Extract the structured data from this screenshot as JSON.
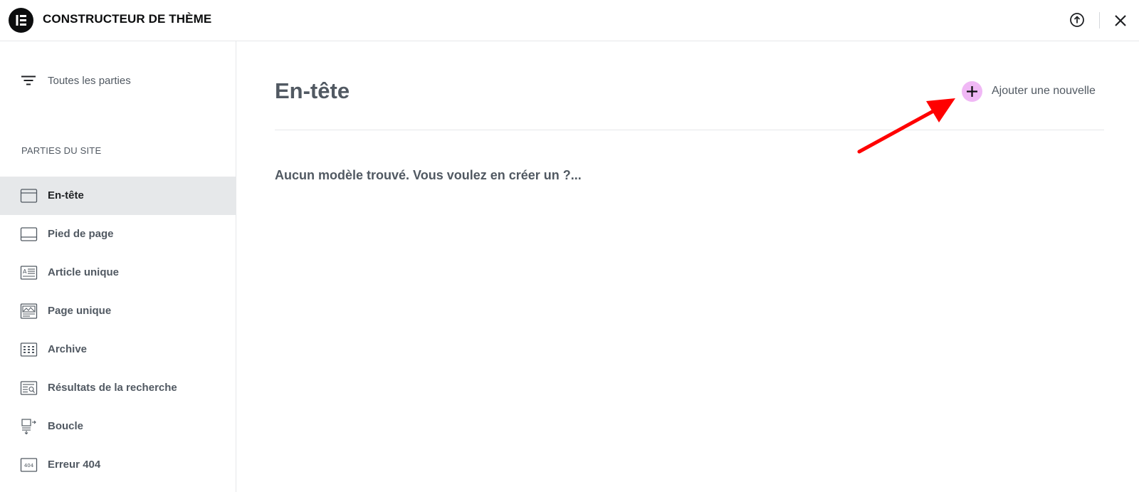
{
  "app": {
    "title": "CONSTRUCTEUR DE THÈME",
    "logo_icon": "elementor-logo"
  },
  "topbar": {
    "help_icon": "arrow-up-circle-icon",
    "close_icon": "close-icon"
  },
  "sidebar": {
    "all_parts_label": "Toutes les parties",
    "section_label": "PARTIES DU SITE",
    "items": [
      {
        "label": "En-tête",
        "icon": "header-icon",
        "active": true
      },
      {
        "label": "Pied de page",
        "icon": "footer-icon",
        "active": false
      },
      {
        "label": "Article unique",
        "icon": "single-post-icon",
        "active": false
      },
      {
        "label": "Page unique",
        "icon": "single-page-icon",
        "active": false
      },
      {
        "label": "Archive",
        "icon": "archive-icon",
        "active": false
      },
      {
        "label": "Résultats de la recherche",
        "icon": "search-results-icon",
        "active": false
      },
      {
        "label": "Boucle",
        "icon": "loop-icon",
        "active": false
      },
      {
        "label": "Erreur 404",
        "icon": "error-404-icon",
        "active": false
      }
    ]
  },
  "main": {
    "title": "En-tête",
    "add_new_label": "Ajouter une nouvelle",
    "empty_message": "Aucun modèle trouvé. Vous voulez en créer un ?..."
  },
  "colors": {
    "accent_add": "#f0b8f5",
    "annotation_arrow": "#ff0000",
    "active_bg": "#e6e8ea",
    "text_muted": "#515962"
  }
}
